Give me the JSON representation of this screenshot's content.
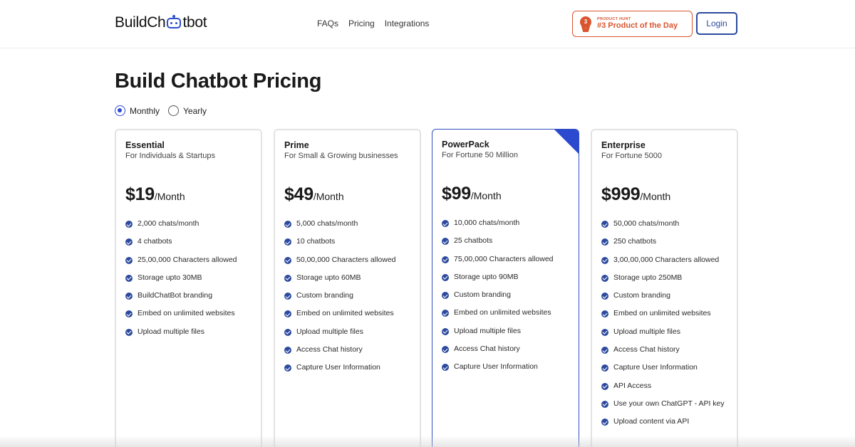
{
  "header": {
    "logo_text_before": "BuildCh",
    "logo_icon": "robot-head-icon",
    "logo_text_after": "tbot",
    "nav": [
      {
        "label": "FAQs"
      },
      {
        "label": "Pricing"
      },
      {
        "label": "Integrations"
      }
    ],
    "product_hunt": {
      "small_label": "PRODUCT HUNT",
      "big_label": "#3 Product of the Day",
      "medal_number": "3",
      "icon": "medal-icon"
    },
    "login_label": "Login"
  },
  "page_title": "Build Chatbot Pricing",
  "billing": {
    "options": [
      {
        "label": "Monthly",
        "selected": true
      },
      {
        "label": "Yearly",
        "selected": false
      }
    ]
  },
  "colors": {
    "accent": "#2c4acf",
    "check": "#2c4a9e",
    "product_hunt": "#da552f"
  },
  "plans": [
    {
      "name": "Essential",
      "subtitle": "For Individuals & Startups",
      "price": "$19",
      "period": "/Month",
      "featured": false,
      "features": [
        "2,000 chats/month",
        "4 chatbots",
        "25,00,000 Characters allowed",
        "Storage upto 30MB",
        "BuildChatBot branding",
        "Embed on unlimited websites",
        "Upload multiple files"
      ]
    },
    {
      "name": "Prime",
      "subtitle": "For Small & Growing businesses",
      "price": "$49",
      "period": "/Month",
      "featured": false,
      "features": [
        "5,000 chats/month",
        "10 chatbots",
        "50,00,000 Characters allowed",
        "Storage upto 60MB",
        "Custom branding",
        "Embed on unlimited websites",
        "Upload multiple files",
        "Access Chat history",
        "Capture User Information"
      ]
    },
    {
      "name": "PowerPack",
      "subtitle": "For Fortune 50 Million",
      "price": "$99",
      "period": "/Month",
      "featured": true,
      "features": [
        "10,000 chats/month",
        "25 chatbots",
        "75,00,000 Characters allowed",
        "Storage upto 90MB",
        "Custom branding",
        "Embed on unlimited websites",
        "Upload multiple files",
        "Access Chat history",
        "Capture User Information"
      ]
    },
    {
      "name": "Enterprise",
      "subtitle": "For Fortune 5000",
      "price": "$999",
      "period": "/Month",
      "featured": false,
      "features": [
        "50,000 chats/month",
        "250 chatbots",
        "3,00,00,000 Characters allowed",
        "Storage upto 250MB",
        "Custom branding",
        "Embed on unlimited websites",
        "Upload multiple files",
        "Access Chat history",
        "Capture User Information",
        "API Access",
        "Use your own ChatGPT - API key",
        "Upload content via API"
      ]
    }
  ]
}
